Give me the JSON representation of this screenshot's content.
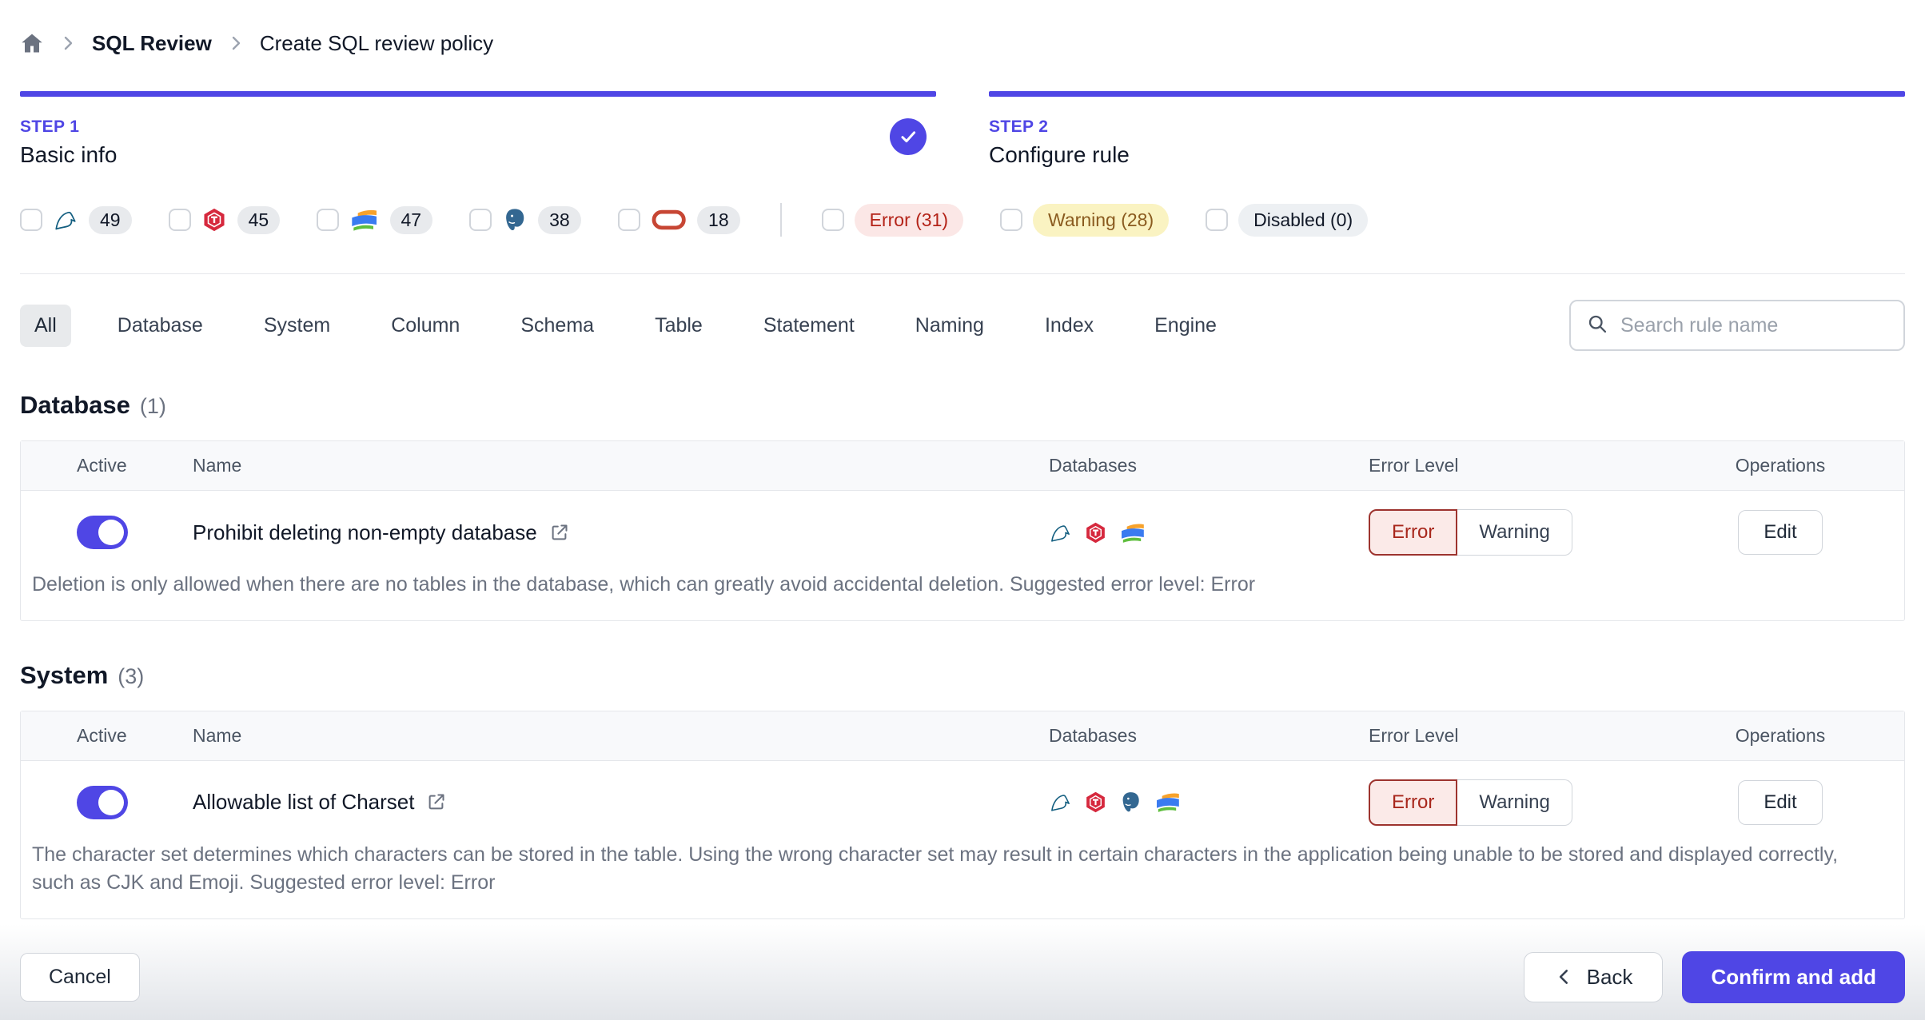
{
  "breadcrumb": {
    "items": [
      {
        "label": "SQL Review"
      },
      {
        "label": "Create SQL review policy"
      }
    ]
  },
  "steps": [
    {
      "label": "STEP 1",
      "title": "Basic info",
      "completed": true
    },
    {
      "label": "STEP 2",
      "title": "Configure rule",
      "completed": false
    }
  ],
  "filters": {
    "engines": [
      {
        "engine": "mysql",
        "count": "49"
      },
      {
        "engine": "tidb",
        "count": "45"
      },
      {
        "engine": "oceanbase",
        "count": "47"
      },
      {
        "engine": "postgresql",
        "count": "38"
      },
      {
        "engine": "oracle",
        "count": "18"
      }
    ],
    "levels": [
      {
        "label": "Error (31)",
        "type": "error"
      },
      {
        "label": "Warning (28)",
        "type": "warning"
      },
      {
        "label": "Disabled (0)",
        "type": "disabled"
      }
    ]
  },
  "tabs": {
    "active": "All",
    "items": [
      "All",
      "Database",
      "System",
      "Column",
      "Schema",
      "Table",
      "Statement",
      "Naming",
      "Index",
      "Engine"
    ]
  },
  "search": {
    "placeholder": "Search rule name"
  },
  "sections": [
    {
      "title": "Database",
      "count": "(1)",
      "columns": [
        "Active",
        "Name",
        "Databases",
        "Error Level",
        "Operations"
      ],
      "rows": [
        {
          "active": true,
          "name": "Prohibit deleting non-empty database",
          "engines": [
            "mysql",
            "tidb",
            "oceanbase"
          ],
          "error_level": "Error",
          "level_options": [
            "Error",
            "Warning"
          ],
          "operation": "Edit",
          "description": "Deletion is only allowed when there are no tables in the database, which can greatly avoid accidental deletion. Suggested error level: Error"
        }
      ]
    },
    {
      "title": "System",
      "count": "(3)",
      "columns": [
        "Active",
        "Name",
        "Databases",
        "Error Level",
        "Operations"
      ],
      "rows": [
        {
          "active": true,
          "name": "Allowable list of Charset",
          "engines": [
            "mysql",
            "tidb",
            "postgresql",
            "oceanbase"
          ],
          "error_level": "Error",
          "level_options": [
            "Error",
            "Warning"
          ],
          "operation": "Edit",
          "description": "The character set determines which characters can be stored in the table. Using the wrong character set may result in certain characters in the application being unable to be stored and displayed correctly, such as CJK and Emoji. Suggested error level: Error"
        }
      ]
    }
  ],
  "footer": {
    "cancel_label": "Cancel",
    "back_label": "Back",
    "confirm_label": "Confirm and add"
  },
  "colors": {
    "accent": "#4f46e5",
    "error_text": "#a8271c",
    "error_bg": "#fbeae8",
    "warning_text": "#8a5b1f",
    "warning_bg": "#faf3c2"
  }
}
